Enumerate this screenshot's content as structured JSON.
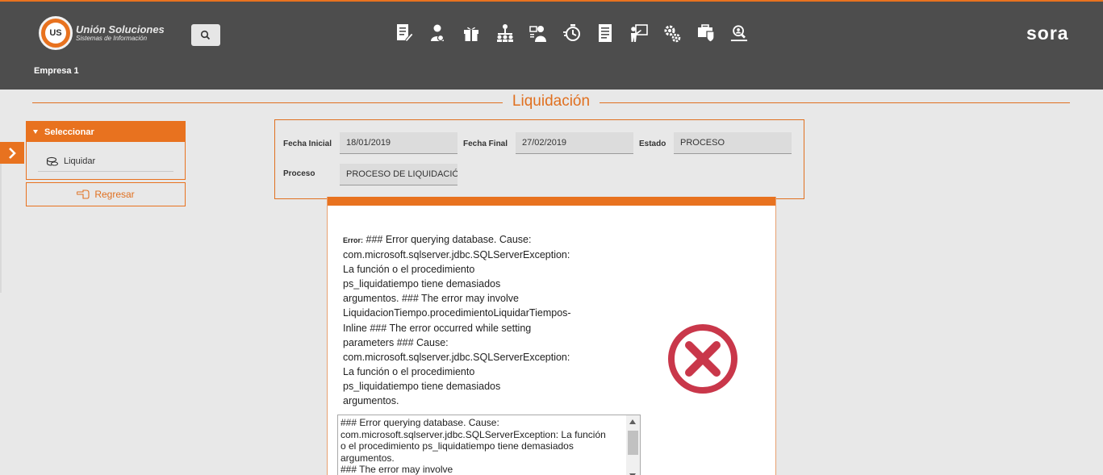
{
  "header": {
    "logo_badge": "US",
    "logo_title": "Unión Soluciones",
    "logo_subtitle": "Sistemas de Información",
    "company": "Empresa 1",
    "brand": "sora",
    "modules": [
      "document-edit-icon",
      "employee-icon",
      "benefits-gift-icon",
      "org-chart-icon",
      "personnel-icon",
      "time-icon",
      "report-icon",
      "training-icon",
      "settings-gears-icon",
      "security-icon",
      "audit-icon"
    ]
  },
  "page": {
    "title": "Liquidación"
  },
  "sidebar": {
    "header": "Seleccionar",
    "items": [
      {
        "label": "Liquidar",
        "icon": "coins-icon"
      }
    ],
    "back_label": "Regresar"
  },
  "form": {
    "fecha_inicial_label": "Fecha Inicial",
    "fecha_inicial": "18/01/2019",
    "fecha_final_label": "Fecha Final",
    "fecha_final": "27/02/2019",
    "estado_label": "Estado",
    "estado": "PROCESO",
    "proceso_label": "Proceso",
    "proceso": "PROCESO DE LIQUIDACIÓN"
  },
  "dialog": {
    "error_prefix": "Error:",
    "error_lines": [
      "### Error querying database. Cause:",
      "com.microsoft.sqlserver.jdbc.SQLServerException:",
      "La función o el procedimiento",
      "ps_liquidatiempo tiene demasiados",
      "argumentos. ### The error may involve",
      "LiquidacionTiempo.procedimientoLiquidarTiempos-",
      "Inline ### The error occurred while setting",
      "parameters ### Cause:",
      "com.microsoft.sqlserver.jdbc.SQLServerException:",
      "La función o el procedimiento",
      "ps_liquidatiempo tiene demasiados",
      "argumentos."
    ],
    "detail_lines": [
      "### Error querying database.  Cause:",
      "com.microsoft.sqlserver.jdbc.SQLServerException: La función",
      "o el procedimiento ps_liquidatiempo tiene demasiados",
      "argumentos.",
      "### The error may involve"
    ],
    "icon": "error-x-icon",
    "accent_color": "#e8721f",
    "error_color": "#c9374a"
  }
}
